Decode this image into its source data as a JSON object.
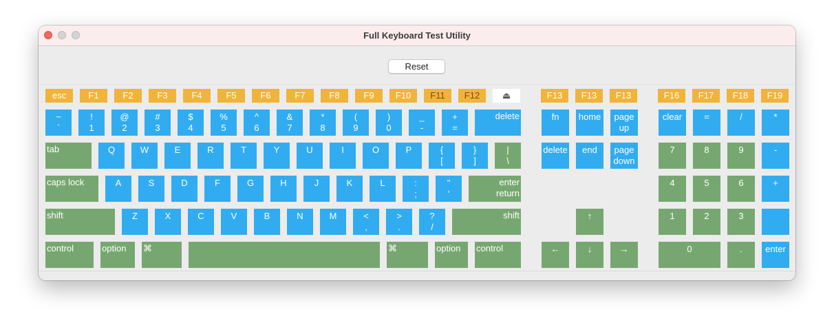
{
  "window": {
    "title": "Full Keyboard Test Utility"
  },
  "toolbar": {
    "reset_label": "Reset"
  },
  "keyboard": {
    "function_row": {
      "esc": "esc",
      "f1": "F1",
      "f2": "F2",
      "f3": "F3",
      "f4": "F4",
      "f5": "F5",
      "f6": "F6",
      "f7": "F7",
      "f8": "F8",
      "f9": "F9",
      "f10": "F10",
      "f11": "F11",
      "f12": "F12",
      "eject": "⏏",
      "f13a": "F13",
      "f13b": "F13",
      "f13c": "F13",
      "f16": "F16",
      "f17": "F17",
      "f18": "F18",
      "f19": "F19"
    },
    "number_row": {
      "tilde": [
        "~",
        "`"
      ],
      "k1": [
        "!",
        "1"
      ],
      "k2": [
        "@",
        "2"
      ],
      "k3": [
        "#",
        "3"
      ],
      "k4": [
        "$",
        "4"
      ],
      "k5": [
        "%",
        "5"
      ],
      "k6": [
        "^",
        "6"
      ],
      "k7": [
        "&",
        "7"
      ],
      "k8": [
        "*",
        "8"
      ],
      "k9": [
        "(",
        "9"
      ],
      "k0": [
        ")",
        "0"
      ],
      "minus": [
        "_",
        "-"
      ],
      "equal": [
        "+",
        "="
      ],
      "delete": "delete"
    },
    "qwerty_row": {
      "tab": "tab",
      "q": "Q",
      "w": "W",
      "e": "E",
      "r": "R",
      "t": "T",
      "y": "Y",
      "u": "U",
      "i": "I",
      "o": "O",
      "p": "P",
      "lbracket": [
        "{",
        "["
      ],
      "rbracket": [
        "}",
        "]"
      ],
      "backslash": [
        "|",
        "\\"
      ]
    },
    "home_row": {
      "caps": "caps lock",
      "a": "A",
      "s": "S",
      "d": "D",
      "f": "F",
      "g": "G",
      "h": "H",
      "j": "J",
      "k": "K",
      "l": "L",
      "semicolon": [
        ":",
        ";"
      ],
      "quote": [
        "\"",
        "'"
      ],
      "enter": [
        "enter",
        "return"
      ]
    },
    "shift_row": {
      "lshift": "shift",
      "z": "Z",
      "x": "X",
      "c": "C",
      "v": "V",
      "b": "B",
      "n": "N",
      "m": "M",
      "comma": [
        "<",
        ","
      ],
      "period": [
        ">",
        "."
      ],
      "slash": [
        "?",
        "/"
      ],
      "rshift": "shift"
    },
    "bottom_row": {
      "lcontrol": "control",
      "loption": "option",
      "lcommand": "⌘",
      "space": "",
      "rcommand": "⌘",
      "roption": "option",
      "rcontrol": "control"
    },
    "nav_cluster": {
      "fn": "fn",
      "home": "home",
      "pageup": [
        "page",
        "up"
      ],
      "fwd_delete": "delete",
      "end": "end",
      "pagedown": [
        "page",
        "down"
      ],
      "up": "↑",
      "left": "←",
      "down": "↓",
      "right": "→"
    },
    "numpad": {
      "clear": "clear",
      "equal": "=",
      "divide": "/",
      "multiply": "*",
      "n7": "7",
      "n8": "8",
      "n9": "9",
      "minus": "-",
      "n4": "4",
      "n5": "5",
      "n6": "6",
      "plus": "+",
      "n1": "1",
      "n2": "2",
      "n3": "3",
      "n0": "0",
      "dot": ".",
      "enter": "enter"
    }
  },
  "colors": {
    "untested_key": "#31acf0",
    "pressed_key": "#77a770",
    "function_key": "#f0b43a",
    "close_button": "#ed6a5e"
  }
}
